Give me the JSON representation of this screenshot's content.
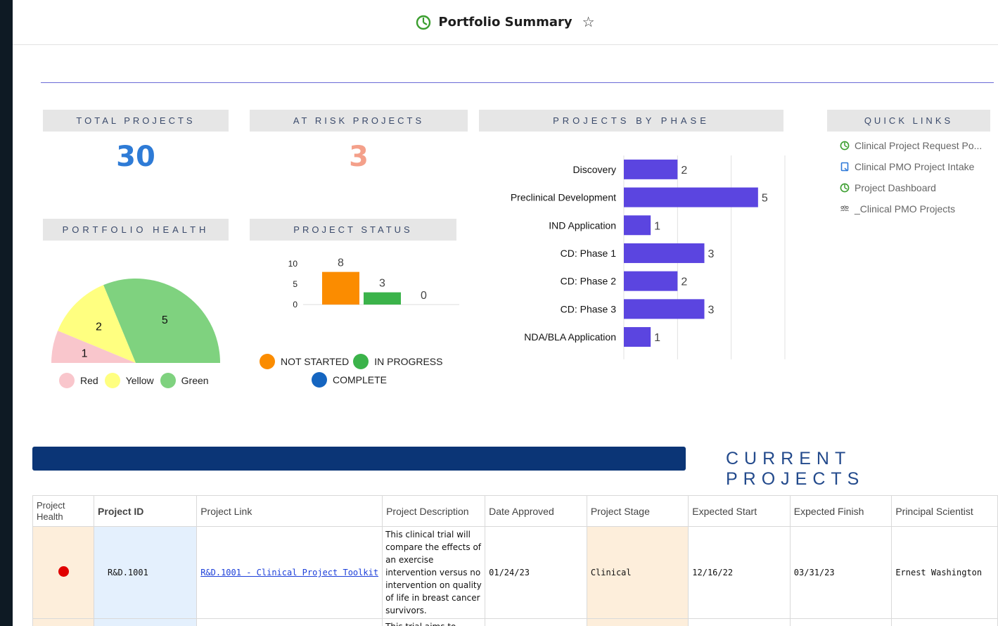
{
  "header": {
    "title": "Portfolio Summary"
  },
  "widgets": {
    "total_projects": {
      "label": "TOTAL PROJECTS",
      "value": "30"
    },
    "at_risk_projects": {
      "label": "AT RISK PROJECTS",
      "value": "3"
    },
    "projects_by_phase": {
      "label": "PROJECTS BY PHASE"
    },
    "portfolio_health": {
      "label": "PORTFOLIO HEALTH"
    },
    "project_status": {
      "label": "PROJECT STATUS"
    },
    "quick_links": {
      "label": "QUICK LINKS",
      "items": [
        {
          "label": "Clinical Project Request Po...",
          "icon": "pie-chart-icon"
        },
        {
          "label": "Clinical PMO Project Intake",
          "icon": "form-icon"
        },
        {
          "label": "Project Dashboard",
          "icon": "pie-chart-icon"
        },
        {
          "label": "_Clinical PMO Projects",
          "icon": "workspace-icon"
        }
      ]
    }
  },
  "chart_data": [
    {
      "type": "bar",
      "orientation": "horizontal",
      "categories": [
        "Discovery",
        "Preclinical Development",
        "IND Application",
        "CD: Phase 1",
        "CD: Phase 2",
        "CD: Phase 3",
        "NDA/BLA Application"
      ],
      "values": [
        2,
        5,
        1,
        3,
        2,
        3,
        1
      ],
      "xlim": [
        0,
        6
      ],
      "grid": true,
      "color": "#5b45e0"
    },
    {
      "type": "bar",
      "categories": [
        "NOT STARTED",
        "IN PROGRESS",
        "COMPLETE"
      ],
      "values": [
        8,
        3,
        0
      ],
      "yticks": [
        "10",
        "5",
        "0"
      ],
      "ylim": [
        0,
        10
      ],
      "colors": [
        "#fb8c00",
        "#3bb34a",
        "#1565c0"
      ],
      "legend": [
        "NOT STARTED",
        "IN PROGRESS",
        "COMPLETE"
      ]
    },
    {
      "type": "pie",
      "style": "half-pie",
      "labels": [
        "Red",
        "Yellow",
        "Green"
      ],
      "values": [
        1,
        2,
        5
      ],
      "colors": [
        "#f9c6cc",
        "#ffff80",
        "#7fd27f"
      ],
      "legend": [
        "Red",
        "Yellow",
        "Green"
      ]
    }
  ],
  "banner": {
    "title": "CURRENT PROJECTS"
  },
  "table": {
    "columns": [
      "Project Health",
      "Project ID",
      "Project Link",
      "Project Description",
      "Date Approved",
      "Project Stage",
      "Expected Start",
      "Expected Finish",
      "Principal Scientist"
    ],
    "rows": [
      {
        "health": "red",
        "id": "R&D.1001",
        "link": "R&D.1001 - Clinical Project Toolkit",
        "description": "This clinical trial will compare the effects of an exercise intervention versus no intervention on quality of life in breast cancer survivors.",
        "date_approved": "01/24/23",
        "stage": "Clinical",
        "expected_start": "12/16/22",
        "expected_finish": "03/31/23",
        "principal_scientist": "Ernest Washington"
      },
      {
        "description": "This trial aims to assess"
      }
    ]
  },
  "colors": {
    "accent": "#2e7bd6",
    "risk": "#f4a08a",
    "bar": "#5b45e0",
    "banner": "#0b3576"
  }
}
